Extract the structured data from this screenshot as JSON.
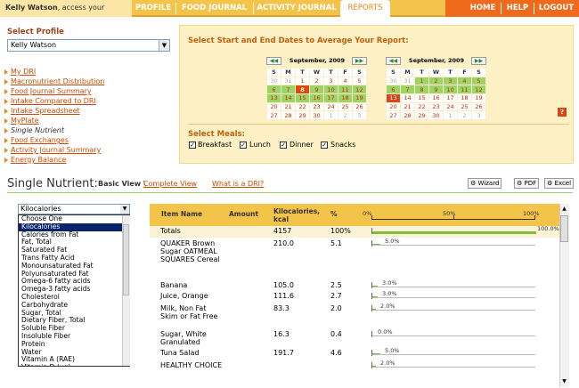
{
  "header": {
    "user_name": "Kelly Watson",
    "user_suffix": ", access your",
    "tabs": [
      "PROFILE",
      "FOOD JOURNAL",
      "ACTIVITY JOURNAL",
      "REPORTS"
    ],
    "active_tab": "REPORTS",
    "right_links": [
      "HOME",
      "HELP",
      "LOGOUT"
    ]
  },
  "sidebar": {
    "select_profile_label": "Select Profile",
    "profile_value": "Kelly Watson",
    "links": [
      "My DRI",
      "Macronutrient Distribution",
      "Food Journal Summary",
      "Intake Compared to DRI",
      "Intake Spreadsheet",
      "MyPlate",
      "Single Nutrient",
      "Food Exchanges",
      "Activity Journal Summary",
      "Energy Balance"
    ],
    "current_link": "Single Nutrient"
  },
  "date_panel": {
    "title": "Select Start and End Dates to Average Your Report:",
    "prev_label": "◀◀",
    "next_label": "▶▶",
    "weekday_headers": [
      "S",
      "M",
      "T",
      "W",
      "T",
      "F",
      "S"
    ],
    "calendars": [
      {
        "title": "September, 2009",
        "weeks": [
          [
            "30",
            "31",
            "1",
            "2",
            "3",
            "4",
            "5"
          ],
          [
            "6",
            "7",
            "8",
            "9",
            "10",
            "11",
            "12"
          ],
          [
            "13",
            "14",
            "15",
            "16",
            "17",
            "18",
            "19"
          ],
          [
            "20",
            "21",
            "22",
            "23",
            "24",
            "25",
            "26"
          ],
          [
            "27",
            "28",
            "29",
            "30",
            "1",
            "2",
            "3"
          ]
        ]
      },
      {
        "title": "September, 2009",
        "weeks": [
          [
            "30",
            "31",
            "1",
            "2",
            "3",
            "4",
            "5"
          ],
          [
            "6",
            "7",
            "8",
            "9",
            "10",
            "11",
            "12"
          ],
          [
            "13",
            "14",
            "15",
            "16",
            "17",
            "18",
            "19"
          ],
          [
            "20",
            "21",
            "22",
            "23",
            "24",
            "25",
            "26"
          ],
          [
            "27",
            "28",
            "29",
            "30",
            "1",
            "2",
            "3"
          ]
        ]
      }
    ],
    "help_label": "?",
    "meals_title": "Select Meals:",
    "meals": [
      {
        "label": "Breakfast",
        "checked": true
      },
      {
        "label": "Lunch",
        "checked": true
      },
      {
        "label": "Dinner",
        "checked": true
      },
      {
        "label": "Snacks",
        "checked": true
      }
    ]
  },
  "report": {
    "title": "Single Nutrient:",
    "basic_view": "Basic View",
    "separator": "\\",
    "complete_view": "Complete View",
    "dri_link": "What is a DRI?",
    "buttons": [
      "Wizard",
      "PDF",
      "Excel"
    ],
    "nutrient_select": "Kilocalories",
    "nutrient_options": [
      "Choose One",
      "Kilocalories",
      "Calories from Fat",
      "Fat, Total",
      "Saturated Fat",
      "Trans Fatty Acid",
      "Monounsaturated Fat",
      "Polyunsaturated Fat",
      "Omega-6 fatty acids",
      "Omega-3 fatty acids",
      "Cholesterol",
      "Carbohydrate",
      "Sugar, Total",
      "Dietary Fiber, Total",
      "Soluble Fiber",
      "Insoluble Fiber",
      "Protein",
      "Water",
      "Vitamin A (RAE)",
      "Vitamin D (ug)"
    ],
    "selected_option": "Kilocalories",
    "columns": [
      "Item Name",
      "Amount",
      "Kilocalories, kcal",
      "%"
    ],
    "scale_labels": [
      "0%",
      "50%",
      "100%"
    ],
    "rows": [
      {
        "name": "Totals",
        "amount": "",
        "kcal": "4157",
        "pct": "100%",
        "bar_pct": 100,
        "bar_label": "100.0%"
      },
      {
        "name": "QUAKER Brown Sugar OATMEAL SQUARES Cereal",
        "amount": "",
        "kcal": "210.0",
        "pct": "5.1",
        "bar_pct": 5.0,
        "bar_label": "5.0%"
      },
      {
        "name": "Banana",
        "amount": "",
        "kcal": "105.0",
        "pct": "2.5",
        "bar_pct": 3.0,
        "bar_label": "3.0%"
      },
      {
        "name": "Juice, Orange",
        "amount": "",
        "kcal": "111.6",
        "pct": "2.7",
        "bar_pct": 3.0,
        "bar_label": "3.0%"
      },
      {
        "name": "Milk, Non Fat Skim or Fat Free",
        "amount": "",
        "kcal": "83.3",
        "pct": "2.0",
        "bar_pct": 2.0,
        "bar_label": "2.0%"
      },
      {
        "name": "Sugar, White Granulated",
        "amount": "",
        "kcal": "16.3",
        "pct": "0.4",
        "bar_pct": 0,
        "bar_label": "0.0%"
      },
      {
        "name": "Tuna Salad",
        "amount": "",
        "kcal": "191.7",
        "pct": "4.6",
        "bar_pct": 5.0,
        "bar_label": "5.0%"
      },
      {
        "name": "HEALTHY CHOICE",
        "amount": "",
        "kcal": "",
        "pct": "",
        "bar_pct": 2.0,
        "bar_label": "2.0%"
      }
    ]
  },
  "colors": {
    "accent": "#f3c34a",
    "orange": "#f06a1c",
    "link": "#c94a00",
    "green": "#9cd468"
  }
}
